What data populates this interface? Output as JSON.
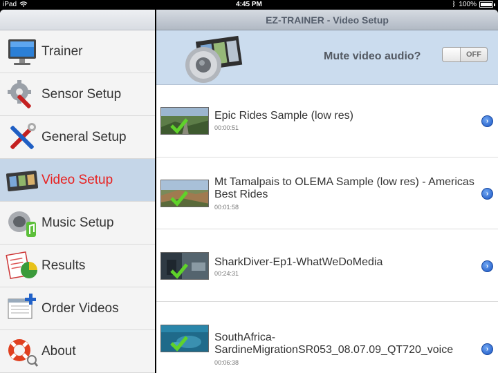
{
  "status_bar": {
    "carrier": "iPad",
    "time": "4:45 PM",
    "battery": "100%"
  },
  "sidebar": {
    "items": [
      {
        "label": "Trainer",
        "icon": "monitor-icon"
      },
      {
        "label": "Sensor Setup",
        "icon": "gear-wrench-icon"
      },
      {
        "label": "General Setup",
        "icon": "tools-icon"
      },
      {
        "label": "Video Setup",
        "icon": "film-strip-icon",
        "selected": true
      },
      {
        "label": "Music Setup",
        "icon": "speaker-music-icon"
      },
      {
        "label": "Results",
        "icon": "chart-report-icon"
      },
      {
        "label": "Order Videos",
        "icon": "order-form-icon"
      },
      {
        "label": "About",
        "icon": "lifebuoy-icon"
      }
    ]
  },
  "detail": {
    "title": "EZ-TRAINER - Video Setup",
    "mute": {
      "label": "Mute video audio?",
      "toggle_text": "OFF",
      "value": false
    },
    "videos": [
      {
        "title": "Epic Rides Sample (low res)",
        "duration": "00:00:51",
        "checked": true
      },
      {
        "title": "Mt Tamalpais to OLEMA Sample (low res) - Americas Best Rides",
        "duration": "00:01:58",
        "checked": true
      },
      {
        "title": "SharkDiver-Ep1-WhatWeDoMedia",
        "duration": "00:24:31",
        "checked": true
      },
      {
        "title": "SouthAfrica-SardineMigrationSR053_08.07.09_QT720_voice",
        "duration": "00:06:38",
        "checked": true
      }
    ]
  },
  "colors": {
    "selected_row": "#c5d6e8",
    "selected_text": "#e8201f",
    "mute_bar": "#cbdcee",
    "disclosure": "#1a55c4"
  }
}
